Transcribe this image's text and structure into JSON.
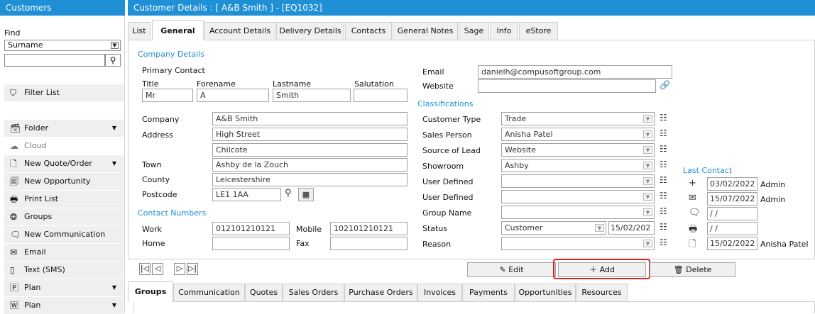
{
  "sidebar": {
    "title": "Customers",
    "find_label": "Find",
    "find_field": "Surname",
    "find_text": "",
    "filter_label": "Filter List",
    "items": [
      {
        "label": "Folder",
        "icon": "folder-icon",
        "glyph": "🗃",
        "chevron": true
      },
      {
        "label": "Cloud",
        "icon": "cloud-icon",
        "glyph": "☁",
        "chevron": false
      },
      {
        "label": "New Quote/Order",
        "icon": "document-icon",
        "glyph": "🗋",
        "chevron": true
      },
      {
        "label": "New Opportunity",
        "icon": "opportunity-icon",
        "glyph": "🗐",
        "chevron": false
      },
      {
        "label": "Print List",
        "icon": "printer-icon",
        "glyph": "🖶",
        "chevron": false
      },
      {
        "label": "Groups",
        "icon": "groups-icon",
        "glyph": "❂",
        "chevron": false
      },
      {
        "label": "New Communication",
        "icon": "message-icon",
        "glyph": "🗨",
        "chevron": false
      },
      {
        "label": "Email",
        "icon": "email-icon",
        "glyph": "✉",
        "chevron": false
      },
      {
        "label": "Text (SMS)",
        "icon": "phone-icon",
        "glyph": "▯",
        "chevron": false
      },
      {
        "label": "Plan",
        "icon": "plan-icon",
        "glyph": "🄿",
        "chevron": true
      },
      {
        "label": "Plan",
        "icon": "word-icon",
        "glyph": "🅆",
        "chevron": true
      }
    ]
  },
  "header": {
    "title": "Customer Details : [ A&B Smith ]  -  [EQ1032]"
  },
  "tabs": [
    "List",
    "General",
    "Account Details",
    "Delivery Details",
    "Contacts",
    "General Notes",
    "Sage",
    "Info",
    "eStore"
  ],
  "active_tab": "General",
  "company": {
    "section_title": "Company Details",
    "primary_contact_label": "Primary Contact",
    "title_label": "Title",
    "title": "Mr",
    "forename_label": "Forename",
    "forename": "A",
    "lastname_label": "Lastname",
    "lastname": "Smith",
    "salutation_label": "Salutation",
    "salutation": "",
    "company_label": "Company",
    "company": "A&B Smith",
    "address_label": "Address",
    "address1": "High Street",
    "address2": "Chilcote",
    "town_label": "Town",
    "town": "Ashby de la Zouch",
    "county_label": "County",
    "county": "Leicestershire",
    "postcode_label": "Postcode",
    "postcode": "LE1 1AA"
  },
  "contact_numbers": {
    "section_title": "Contact Numbers",
    "work_label": "Work",
    "work": "012101210121",
    "mobile_label": "Mobile",
    "mobile": "102101210121",
    "home_label": "Home",
    "home": "",
    "fax_label": "Fax",
    "fax": ""
  },
  "contact": {
    "email_label": "Email",
    "email": "danielh@compusoftgroup.com",
    "website_label": "Website",
    "website": ""
  },
  "classifications": {
    "section_title": "Classifications",
    "rows": [
      {
        "label": "Customer Type",
        "value": "Trade"
      },
      {
        "label": "Sales Person",
        "value": "Anisha Patel"
      },
      {
        "label": "Source of Lead",
        "value": "Website"
      },
      {
        "label": "Showroom",
        "value": "Ashby"
      },
      {
        "label": "User Defined",
        "value": ""
      },
      {
        "label": "User Defined",
        "value": ""
      },
      {
        "label": "Group Name",
        "value": ""
      },
      {
        "label": "Status",
        "value": "Customer",
        "date": "15/02/202"
      },
      {
        "label": "Reason",
        "value": ""
      }
    ]
  },
  "last_contact": {
    "title": "Last Contact",
    "rows": [
      {
        "icon": "plus-icon",
        "glyph": "+",
        "date": "03/02/2022",
        "user": "Admin"
      },
      {
        "icon": "email-open-icon",
        "glyph": "✉",
        "date": "15/07/2022",
        "user": "Admin"
      },
      {
        "icon": "message-icon",
        "glyph": "🗨",
        "date": " / /",
        "user": ""
      },
      {
        "icon": "printer-icon",
        "glyph": "🖶",
        "date": " / /",
        "user": ""
      },
      {
        "icon": "document-icon",
        "glyph": "🗋",
        "date": "15/02/2022",
        "user": "Anisha Patel"
      }
    ]
  },
  "actions": {
    "edit": "Edit",
    "add": "Add",
    "delete": "Delete"
  },
  "bottom_tabs": [
    "Groups",
    "Communication",
    "Quotes",
    "Sales Orders",
    "Purchase Orders",
    "Invoices",
    "Payments",
    "Opportunities",
    "Resources"
  ],
  "active_bottom_tab": "Groups",
  "colors": {
    "accent": "#1f8fd6",
    "highlight": "#e02020"
  }
}
